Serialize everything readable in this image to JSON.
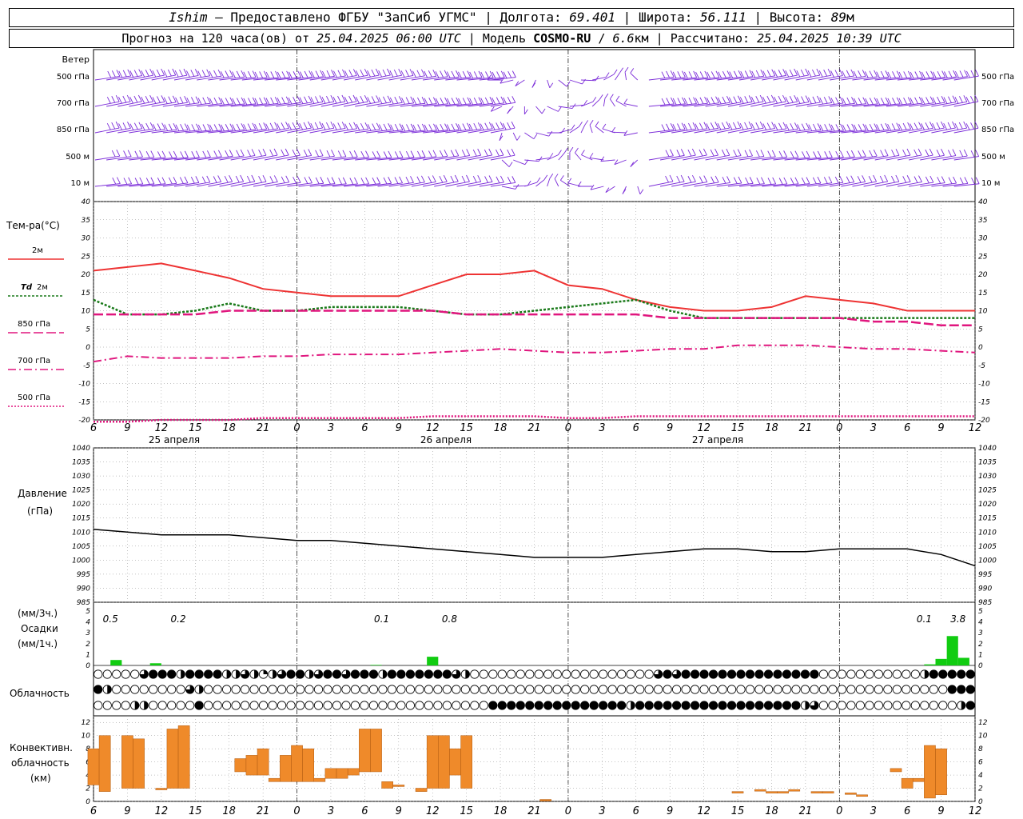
{
  "header": {
    "station": "Ishim",
    "provider": "Предоставлено ФГБУ \"ЗапСиб УГМС\"",
    "lon_label": "Долгота:",
    "lon": "69.401",
    "lat_label": "Широта:",
    "lat": "56.111",
    "alt_label": "Высота:",
    "alt": "89",
    "alt_unit": "м",
    "forecast_prefix": "Прогноз на 120 часа(ов) от",
    "forecast_start": "25.04.2025 06:00 UTC",
    "model_label": "Модель",
    "model": "COSMO-RU",
    "resolution": "6.6",
    "resolution_unit": "км",
    "calc_label": "Рассчитано:",
    "calc_time": "25.04.2025 10:39 UTC"
  },
  "labels": {
    "wind": "Ветер",
    "wind_levels": [
      "500 гПа",
      "700 гПа",
      "850 гПа",
      "500 м",
      "10  м"
    ],
    "temp": "Тем-ра(°С)",
    "leg_2m": "2м",
    "leg_td_a": "Td",
    "leg_td_b": "2м",
    "leg_850": "850 гПа",
    "leg_700": "700 гПа",
    "leg_500": "500 гПа",
    "pressure_a": "Давление",
    "pressure_b": "(гПа)",
    "precip_a": "(мм/3ч.)",
    "precip_b": "Осадки",
    "precip_c": "(мм/1ч.)",
    "cloud": "Облачность",
    "conv_a": "Конвективн.",
    "conv_b": "облачность",
    "conv_c": "(км)",
    "day1": "25 апреля",
    "day2": "26 апреля",
    "day3": "27 апреля"
  },
  "x_ticks": [
    "6",
    "9",
    "12",
    "15",
    "18",
    "21",
    "0",
    "3",
    "6",
    "9",
    "12",
    "15",
    "18",
    "21",
    "0",
    "3",
    "6",
    "9",
    "12",
    "15",
    "18",
    "21",
    "0",
    "3",
    "6",
    "9",
    "12"
  ],
  "colors": {
    "wind": "#7a2ad8",
    "t2m": "#ee3333",
    "td": "#1a7a1a",
    "t850": "#e0167e",
    "t700": "#e0167e",
    "t500": "#e0167e",
    "pressure": "#000000",
    "precip": "#11cc11",
    "conv": "#ef8a2a"
  },
  "chart_data": [
    {
      "type": "line",
      "name": "temperature",
      "title": "Тем-ра(°С)",
      "ylim": [
        -20,
        40
      ],
      "yticks": [
        -20,
        -15,
        -10,
        -5,
        0,
        5,
        10,
        15,
        20,
        25,
        30,
        35,
        40
      ],
      "x_hours": [
        0,
        3,
        6,
        9,
        12,
        15,
        18,
        21,
        24,
        27,
        30,
        33,
        36,
        39,
        42,
        45,
        48,
        51,
        54,
        57,
        60,
        63,
        66,
        69,
        72,
        75,
        78
      ],
      "series": [
        {
          "name": "2м",
          "values": [
            21,
            22,
            23,
            21,
            19,
            16,
            15,
            14,
            14,
            14,
            17,
            20,
            20,
            21,
            17,
            16,
            13,
            11,
            10,
            10,
            11,
            14,
            13,
            12,
            10,
            10,
            10
          ]
        },
        {
          "name": "Td 2м",
          "values": [
            13,
            9,
            9,
            10,
            12,
            10,
            10,
            11,
            11,
            11,
            10,
            9,
            9,
            10,
            11,
            12,
            13,
            10,
            8,
            8,
            8,
            8,
            8,
            8,
            8,
            8,
            8
          ]
        },
        {
          "name": "850 гПа",
          "values": [
            9,
            9,
            9,
            9,
            10,
            10,
            10,
            10,
            10,
            10,
            10,
            9,
            9,
            9,
            9,
            9,
            9,
            8,
            8,
            8,
            8,
            8,
            8,
            7,
            7,
            6,
            6
          ]
        },
        {
          "name": "700 гПа",
          "values": [
            -4,
            -2.5,
            -3,
            -3,
            -3,
            -2.5,
            -2.5,
            -2,
            -2,
            -2,
            -1.5,
            -1,
            -0.5,
            -1,
            -1.5,
            -1.5,
            -1,
            -0.5,
            -0.5,
            0.5,
            0.5,
            0.5,
            0,
            -0.5,
            -0.5,
            -1,
            -1.5
          ]
        },
        {
          "name": "500 гПа",
          "values": [
            -20.5,
            -20.5,
            -20,
            -20,
            -20,
            -19.5,
            -19.5,
            -19.5,
            -19.5,
            -19.5,
            -19,
            -19,
            -19,
            -19,
            -19.5,
            -19.5,
            -19,
            -19,
            -19,
            -19,
            -19,
            -19,
            -19,
            -19,
            -19,
            -19,
            -19
          ]
        }
      ]
    },
    {
      "type": "line",
      "name": "pressure",
      "title": "Давление (гПа)",
      "ylim": [
        985,
        1040
      ],
      "yticks": [
        985,
        990,
        995,
        1000,
        1005,
        1010,
        1015,
        1020,
        1025,
        1030,
        1035,
        1040
      ],
      "x_hours": [
        0,
        3,
        6,
        9,
        12,
        15,
        18,
        21,
        24,
        27,
        30,
        33,
        36,
        39,
        42,
        45,
        48,
        51,
        54,
        57,
        60,
        63,
        66,
        69,
        72,
        75,
        78
      ],
      "values": [
        1011,
        1010,
        1009,
        1009,
        1009,
        1008,
        1007,
        1007,
        1006,
        1005,
        1004,
        1003,
        1002,
        1001,
        1001,
        1001,
        1002,
        1003,
        1004,
        1004,
        1003,
        1003,
        1004,
        1004,
        1004,
        1002,
        998
      ]
    },
    {
      "type": "bar",
      "name": "precipitation",
      "title": "Осадки",
      "ylim": [
        0,
        5
      ],
      "yticks": [
        0,
        1,
        2,
        3,
        4,
        5
      ],
      "bars": [
        {
          "h": 2.0,
          "v": 0.5
        },
        {
          "h": 5.5,
          "v": 0.2
        },
        {
          "h": 25.0,
          "v": 0.05
        },
        {
          "h": 30.0,
          "v": 0.8
        },
        {
          "h": 74.0,
          "v": 0.1
        },
        {
          "h": 75.0,
          "v": 0.6
        },
        {
          "h": 76.0,
          "v": 2.7
        },
        {
          "h": 77.0,
          "v": 0.7
        }
      ],
      "totals": [
        {
          "h": 1.5,
          "label": "0.5"
        },
        {
          "h": 7.5,
          "label": "0.2"
        },
        {
          "h": 25.5,
          "label": "0.1"
        },
        {
          "h": 31.5,
          "label": "0.8"
        },
        {
          "h": 73.5,
          "label": "0.1"
        },
        {
          "h": 76.5,
          "label": "3.8"
        }
      ]
    },
    {
      "type": "bar",
      "name": "convective_cloud",
      "title": "Конвективн. облачность (км)",
      "ylim": [
        0,
        13
      ],
      "yticks": [
        0,
        2,
        4,
        6,
        8,
        10,
        12
      ],
      "bars": [
        {
          "h": 0,
          "lo": 2.5,
          "hi": 8
        },
        {
          "h": 1,
          "lo": 1.5,
          "hi": 10
        },
        {
          "h": 3,
          "lo": 2,
          "hi": 10
        },
        {
          "h": 4,
          "lo": 2,
          "hi": 9.5
        },
        {
          "h": 6,
          "lo": 2,
          "hi": 2
        },
        {
          "h": 7,
          "lo": 2,
          "hi": 11
        },
        {
          "h": 8,
          "lo": 2,
          "hi": 11.5
        },
        {
          "h": 13,
          "lo": 4.5,
          "hi": 6.5
        },
        {
          "h": 14,
          "lo": 4,
          "hi": 7
        },
        {
          "h": 15,
          "lo": 4,
          "hi": 8
        },
        {
          "h": 16,
          "lo": 3,
          "hi": 3.5
        },
        {
          "h": 17,
          "lo": 3,
          "hi": 7
        },
        {
          "h": 18,
          "lo": 3,
          "hi": 8.5
        },
        {
          "h": 19,
          "lo": 3,
          "hi": 8
        },
        {
          "h": 20,
          "lo": 3,
          "hi": 3.5
        },
        {
          "h": 21,
          "lo": 3.5,
          "hi": 5
        },
        {
          "h": 22,
          "lo": 3.5,
          "hi": 5
        },
        {
          "h": 23,
          "lo": 4,
          "hi": 5
        },
        {
          "h": 24,
          "lo": 4.5,
          "hi": 11
        },
        {
          "h": 25,
          "lo": 4.5,
          "hi": 11
        },
        {
          "h": 26,
          "lo": 2,
          "hi": 3
        },
        {
          "h": 27,
          "lo": 2.5,
          "hi": 2.5
        },
        {
          "h": 29,
          "lo": 1.5,
          "hi": 2
        },
        {
          "h": 30,
          "lo": 2,
          "hi": 10
        },
        {
          "h": 31,
          "lo": 2,
          "hi": 10
        },
        {
          "h": 32,
          "lo": 4,
          "hi": 8
        },
        {
          "h": 33,
          "lo": 2,
          "hi": 10
        },
        {
          "h": 40,
          "lo": 0.3,
          "hi": 0.3
        },
        {
          "h": 57,
          "lo": 1.5,
          "hi": 1.5
        },
        {
          "h": 59,
          "lo": 1.8,
          "hi": 1.8
        },
        {
          "h": 60,
          "lo": 1.5,
          "hi": 1.5
        },
        {
          "h": 61,
          "lo": 1.5,
          "hi": 1.5
        },
        {
          "h": 62,
          "lo": 1.8,
          "hi": 1.8
        },
        {
          "h": 64,
          "lo": 1.5,
          "hi": 1.5
        },
        {
          "h": 65,
          "lo": 1.5,
          "hi": 1.5
        },
        {
          "h": 67,
          "lo": 1.3,
          "hi": 1.3
        },
        {
          "h": 68,
          "lo": 1,
          "hi": 1
        },
        {
          "h": 71,
          "lo": 4.5,
          "hi": 5
        },
        {
          "h": 72,
          "lo": 2,
          "hi": 3.5
        },
        {
          "h": 73,
          "lo": 3,
          "hi": 3.5
        },
        {
          "h": 74,
          "lo": 0.5,
          "hi": 8.5
        },
        {
          "h": 75,
          "lo": 1,
          "hi": 8
        }
      ]
    },
    {
      "type": "table",
      "name": "cloudiness",
      "title": "Облачность",
      "encoding": "0=clear,1=quarter,2=half,3=three-quarter,4=overcast; one symbol per hour",
      "rows": [
        [
          0,
          0,
          0,
          0,
          0,
          3,
          4,
          4,
          4,
          2,
          4,
          4,
          4,
          4,
          2,
          2,
          3,
          2,
          1,
          2,
          3,
          4,
          4,
          2,
          3,
          4,
          4,
          3,
          4,
          4,
          4,
          2,
          4,
          4,
          4,
          4,
          4,
          4,
          4,
          3,
          2,
          0,
          0,
          0,
          0,
          0,
          0,
          0,
          0,
          0,
          0,
          0,
          0,
          0,
          0,
          0,
          0,
          0,
          0,
          0,
          0,
          3,
          4,
          3,
          4,
          4,
          4,
          4,
          4,
          4,
          4,
          4,
          4,
          4,
          4,
          4,
          4,
          4,
          4,
          0,
          0,
          0,
          0,
          0,
          0,
          0,
          0,
          0,
          0,
          0,
          2,
          4,
          4,
          4,
          4,
          4
        ],
        [
          4,
          2,
          0,
          0,
          0,
          0,
          0,
          0,
          0,
          0,
          3,
          2,
          0,
          0,
          0,
          0,
          0,
          0,
          0,
          0,
          0,
          0,
          0,
          0,
          0,
          0,
          0,
          0,
          0,
          0,
          0,
          0,
          0,
          0,
          0,
          0,
          0,
          0,
          0,
          0,
          0,
          0,
          0,
          0,
          0,
          0,
          0,
          0,
          0,
          0,
          0,
          0,
          0,
          0,
          0,
          0,
          0,
          0,
          0,
          0,
          0,
          0,
          0,
          0,
          0,
          0,
          0,
          0,
          0,
          0,
          0,
          0,
          0,
          0,
          0,
          0,
          0,
          0,
          0,
          0,
          0,
          0,
          0,
          0,
          0,
          0,
          0,
          0,
          0,
          0,
          0,
          0,
          0,
          4,
          4,
          4
        ],
        [
          0,
          0,
          0,
          0,
          2,
          2,
          0,
          0,
          0,
          0,
          0,
          4,
          0,
          0,
          0,
          0,
          0,
          0,
          0,
          0,
          0,
          0,
          0,
          0,
          0,
          0,
          0,
          0,
          0,
          0,
          0,
          0,
          0,
          0,
          0,
          0,
          0,
          0,
          0,
          0,
          0,
          0,
          0,
          4,
          4,
          4,
          4,
          4,
          4,
          4,
          4,
          4,
          4,
          4,
          4,
          4,
          4,
          4,
          2,
          4,
          4,
          4,
          4,
          4,
          4,
          4,
          4,
          4,
          4,
          4,
          4,
          4,
          4,
          4,
          4,
          4,
          4,
          2,
          3,
          0,
          0,
          0,
          0,
          0,
          0,
          0,
          0,
          0,
          0,
          0,
          0,
          0,
          0,
          0,
          2,
          4
        ]
      ]
    }
  ]
}
